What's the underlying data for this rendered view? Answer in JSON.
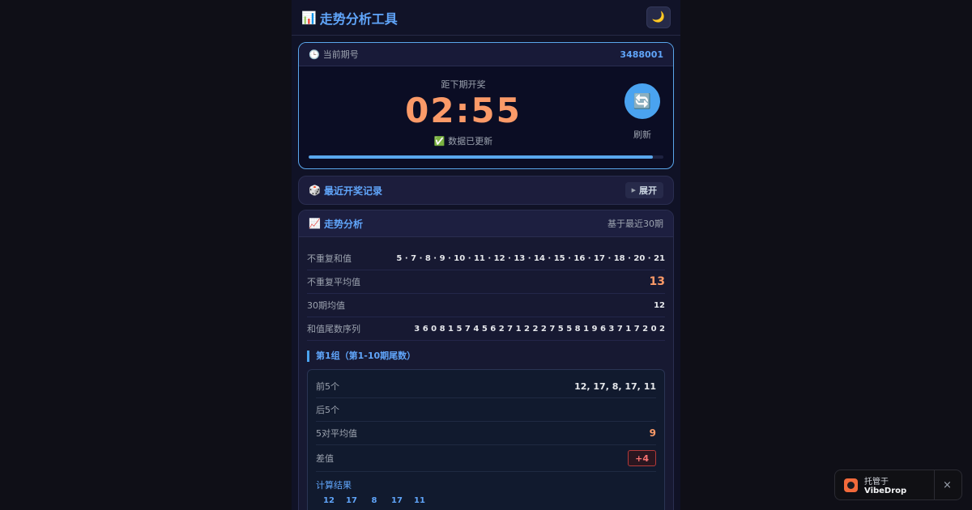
{
  "header": {
    "title_icon": "bar-chart-icon",
    "title": "走势分析工具",
    "theme_toggle_icon": "🌙"
  },
  "period": {
    "label": "当前期号",
    "number": "3488001",
    "countdown_label": "距下期开奖",
    "countdown": "02:55",
    "status": "数据已更新",
    "refresh_label": "刷新",
    "refresh_icon": "🔄",
    "progress": 0.97
  },
  "history": {
    "title": "最近开奖记录",
    "expand_label": "展开"
  },
  "trend": {
    "title": "走势分析",
    "basis": "基于最近30期",
    "stats": [
      {
        "label": "不重复和值",
        "value": "5 · 7 · 8 · 9 · 10 · 11 · 12 · 13 · 14 · 15 · 16 · 17 · 18 · 20 · 21"
      },
      {
        "label": "不重复平均值",
        "value": "13"
      },
      {
        "label": "30期均值",
        "value": "12"
      },
      {
        "label": "和值尾数序列",
        "value": "3 6 0 8 1 5 7 4 5 6 2 7 1 2 2 2 7 5 5 8 1 9 6 3 7 1 7 2 0 2"
      }
    ],
    "group": {
      "title": "第1组（第1-10期尾数）",
      "rows": {
        "first5_label": "前5个",
        "first5_value": "12, 17, 8, 17, 11",
        "last5_label": "后5个",
        "last5_value": "",
        "avg_label": "5对平均值",
        "avg_value": "9",
        "diff_label": "差值",
        "diff_value": "+4"
      },
      "calc_title": "计算结果",
      "calc_values": [
        "12",
        "17",
        "8",
        "17",
        "11"
      ]
    }
  },
  "vibedrop": {
    "prefix": "托管于",
    "brand": "VibeDrop",
    "close": "×"
  }
}
